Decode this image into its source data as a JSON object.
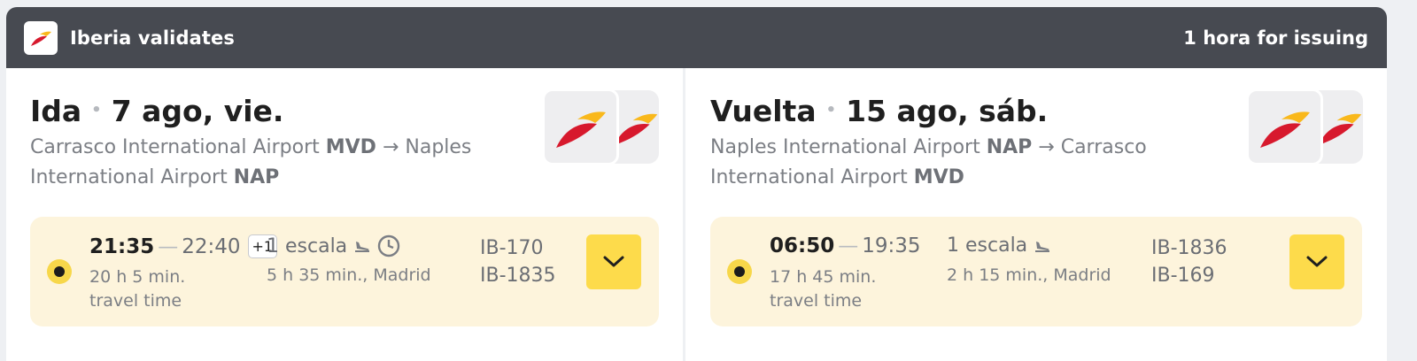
{
  "header": {
    "airline": "Iberia validates",
    "issuing": "1 hora for issuing"
  },
  "outbound": {
    "label": "Ida",
    "date": "7 ago, vie.",
    "origin_name": "Carrasco International Airport",
    "origin_code": "MVD",
    "arrow": "→",
    "destination_name": "Naples International Airport",
    "destination_code": "NAP",
    "departure": "21:35",
    "arrival": "22:40",
    "day_offset": "+1",
    "duration": "20 h 5 min.",
    "duration_suffix": "travel time",
    "stops": "1 escala",
    "stop_detail": "5 h 35 min., Madrid",
    "flights": [
      "IB-170",
      "IB-1835"
    ]
  },
  "return": {
    "label": "Vuelta",
    "date": "15 ago, sáb.",
    "origin_name": "Naples International Airport",
    "origin_code": "NAP",
    "arrow": "→",
    "destination_name": "Carrasco International Airport",
    "destination_code": "MVD",
    "departure": "06:50",
    "arrival": "19:35",
    "duration": "17 h 45 min.",
    "duration_suffix": "travel time",
    "stops": "1 escala",
    "stop_detail": "2 h 15 min., Madrid",
    "flights": [
      "IB-1836",
      "IB-169"
    ]
  },
  "icons": {
    "airline_logo": "iberia-logo",
    "layover": "airplane-landing-icon",
    "long_layover": "clock-icon",
    "expand": "chevron-down-icon"
  },
  "colors": {
    "header_bg": "#474a51",
    "segment_bg": "#fdf4dc",
    "accent_yellow": "#fddb4b",
    "iberia_red": "#d7192d",
    "iberia_yellow": "#f9b81b"
  }
}
